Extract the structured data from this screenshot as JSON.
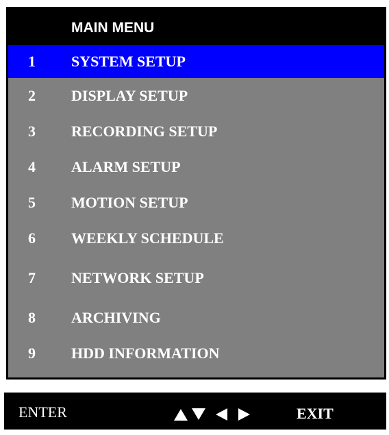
{
  "menu": {
    "title": "MAIN MENU",
    "selected_index": 0,
    "items": [
      {
        "number": "1",
        "label": "SYSTEM SETUP"
      },
      {
        "number": "2",
        "label": "DISPLAY SETUP"
      },
      {
        "number": "3",
        "label": "RECORDING SETUP"
      },
      {
        "number": "4",
        "label": "ALARM SETUP"
      },
      {
        "number": "5",
        "label": "MOTION SETUP"
      },
      {
        "number": "6",
        "label": "WEEKLY SCHEDULE"
      },
      {
        "number": "7",
        "label": "NETWORK SETUP"
      },
      {
        "number": "8",
        "label": "ARCHIVING"
      },
      {
        "number": "9",
        "label": "HDD INFORMATION"
      }
    ]
  },
  "footer": {
    "enter_label": "ENTER",
    "exit_label": "EXIT",
    "arrows": [
      "up-arrow-icon",
      "down-arrow-icon",
      "left-arrow-icon",
      "right-arrow-icon"
    ]
  },
  "colors": {
    "panel_background": "#000000",
    "menu_background": "#808080",
    "selected_highlight": "#0000ff",
    "text": "#ffffff"
  }
}
